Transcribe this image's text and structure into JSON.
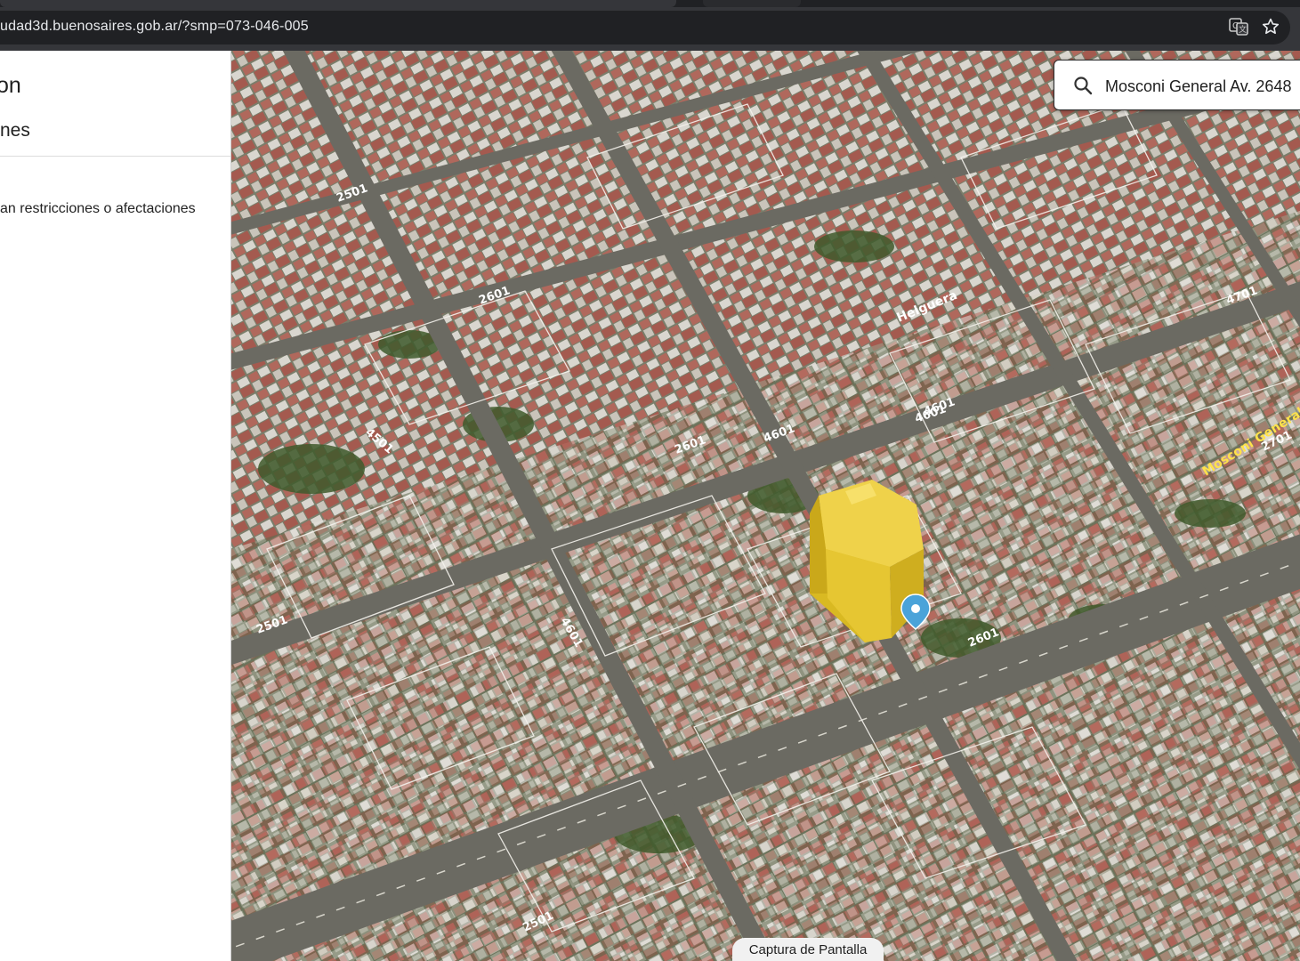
{
  "browser": {
    "url": "udad3d.buenosaires.gob.ar/?smp=073-046-005",
    "icons": [
      "translate-icon",
      "star-icon"
    ]
  },
  "panel": {
    "title": "on",
    "tab_label": "nes",
    "note": "an restricciones o afectaciones"
  },
  "search": {
    "icon": "search-icon",
    "value": "Mosconi General Av. 2648"
  },
  "map": {
    "street_labels": [
      "2601",
      "4601",
      "2501",
      "4501",
      "4601",
      "2501",
      "2601",
      "4601",
      "2601",
      "2501",
      "2701",
      "4701",
      "4601"
    ],
    "street_names": [
      "Mosconi General Av.",
      "Helguera"
    ],
    "marker": "location-pin-icon",
    "building_color": "#e8c72a",
    "marker_color": "#4aa3d9"
  },
  "capture_button": {
    "label": "Captura de Pantalla"
  }
}
